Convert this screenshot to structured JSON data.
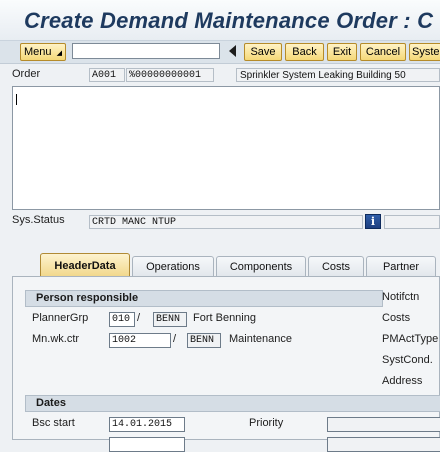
{
  "title": "Create Demand Maintenance Order : C",
  "toolbar": {
    "menu_label": "Menu",
    "save_label": "Save",
    "back_label": "Back",
    "exit_label": "Exit",
    "cancel_label": "Cancel",
    "system_label": "Syste"
  },
  "header": {
    "order_label": "Order",
    "order_type": "A001",
    "order_number": "%00000000001",
    "order_description": "Sprinkler System Leaking Building 50",
    "sys_status_label": "Sys.Status",
    "sys_status_value": "CRTD  MANC  NTUP"
  },
  "tabs": [
    {
      "label": "HeaderData",
      "active": true
    },
    {
      "label": "Operations",
      "active": false
    },
    {
      "label": "Components",
      "active": false
    },
    {
      "label": "Costs",
      "active": false
    },
    {
      "label": "Partner",
      "active": false
    }
  ],
  "person_responsible": {
    "heading": "Person responsible",
    "planner_group_label": "PlannerGrp",
    "planner_group_value": "010",
    "planner_group_sep": "/",
    "planner_plant": "BENN",
    "planner_group_text": "Fort Benning",
    "main_workctr_label": "Mn.wk.ctr",
    "main_workctr_value": "1002",
    "main_workctr_sep": "/",
    "main_workctr_plant": "BENN",
    "main_workctr_text": "Maintenance"
  },
  "right_labels": {
    "notification": "Notifctn",
    "costs": "Costs",
    "pm_act_type": "PMActType",
    "syst_cond": "SystCond.",
    "address": "Address"
  },
  "dates": {
    "heading": "Dates",
    "basic_start_label": "Bsc start",
    "basic_start_value": "14.01.2015",
    "priority_label": "Priority"
  },
  "icons": {
    "info": "info-icon",
    "navigate_back": "triangle-left-icon",
    "menu_dropdown": "dropdown-triangle-icon"
  },
  "colors": {
    "title_text": "#1e3a5f",
    "button_fill": "#f5d878",
    "active_tab_fill": "#f2d88c",
    "info_button": "#2f5da8"
  }
}
